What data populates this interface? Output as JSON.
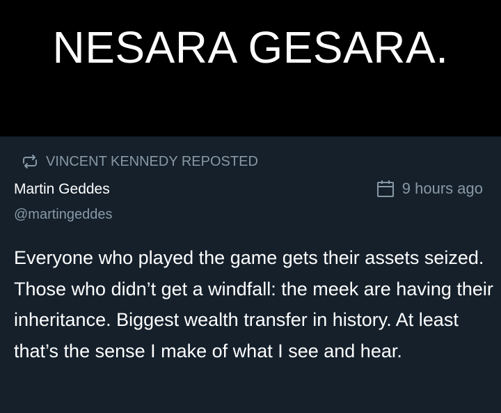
{
  "banner": {
    "title": "NESARA GESARA."
  },
  "post": {
    "repost_label": "VINCENT KENNEDY REPOSTED",
    "repost_icon": "repost-icon",
    "author_name": "Martin Geddes",
    "author_handle": "@martingeddes",
    "timestamp_icon": "calendar-icon",
    "timestamp": "9 hours ago",
    "body": "Everyone who played the game gets their assets seized. Those who didn’t get a windfall: the meek are having their inheritance. Biggest wealth transfer in history. At least that’s the sense I make of what I see and hear."
  },
  "colors": {
    "banner_bg": "#000000",
    "post_bg": "#15202b",
    "primary_text": "#ffffff",
    "secondary_text": "#8899a6"
  }
}
